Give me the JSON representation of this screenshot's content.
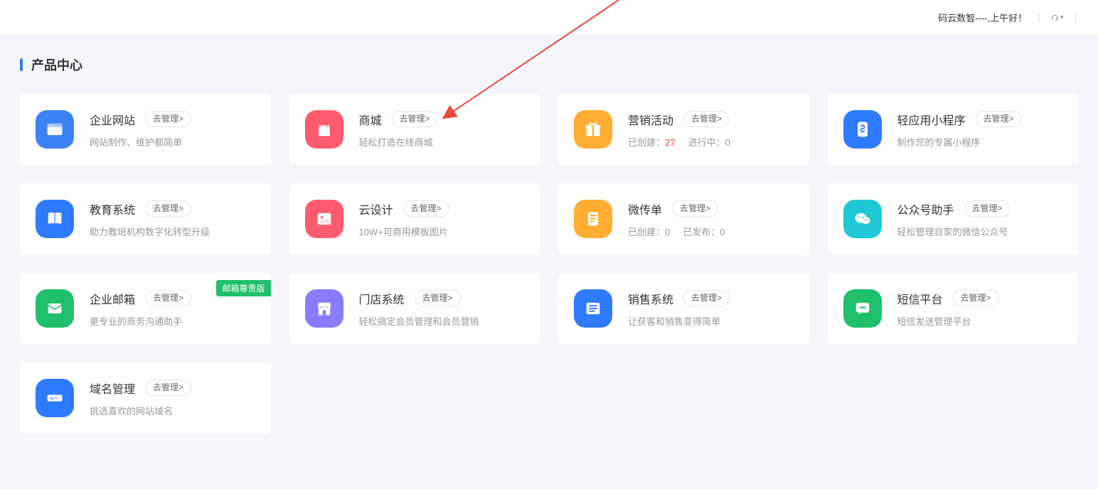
{
  "header": {
    "greeting": "码云数智----,上午好！"
  },
  "section_title": "产品中心",
  "manage_label": "去管理>",
  "cards": [
    {
      "title": "企业网站",
      "desc": "网站制作、维护都简单",
      "icon": "window",
      "color": "#3b82f6",
      "badge": null
    },
    {
      "title": "商城",
      "desc": "轻松打造在线商城",
      "icon": "bag",
      "color": "#ff5b6e",
      "badge": null
    },
    {
      "title": "营销活动",
      "desc_created_label": "已创建：",
      "desc_created_val": "27",
      "desc_running_label": "进行中：",
      "desc_running_val": "0",
      "icon": "gift",
      "color": "#ffad33",
      "badge": null
    },
    {
      "title": "轻应用小程序",
      "desc": "制作您的专属小程序",
      "icon": "miniprog",
      "color": "#2f7bff",
      "badge": null
    },
    {
      "title": "教育系统",
      "desc": "助力教培机构数字化转型升级",
      "icon": "book",
      "color": "#2f7bff",
      "badge": null
    },
    {
      "title": "云设计",
      "desc": "10W+可商用模板图片",
      "icon": "image",
      "color": "#ff5b6e",
      "badge": null
    },
    {
      "title": "微传单",
      "desc_created_label": "已创建：",
      "desc_created_val": "0",
      "desc_running_label": "已发布：",
      "desc_running_val": "0",
      "icon": "flyer",
      "color": "#ffad33",
      "badge": null
    },
    {
      "title": "公众号助手",
      "desc": "轻松管理自家的微信公众号",
      "icon": "wechat",
      "color": "#1fc8d6",
      "badge": null
    },
    {
      "title": "企业邮箱",
      "desc": "更专业的商务沟通助手",
      "icon": "envelope",
      "color": "#1fbf6c",
      "badge": "邮箱尊贵版"
    },
    {
      "title": "门店系统",
      "desc": "轻松搞定会员管理和会员营销",
      "icon": "store",
      "color": "#8b7bff",
      "badge": null
    },
    {
      "title": "销售系统",
      "desc": "让获客和销售变得简单",
      "icon": "list",
      "color": "#2f7bff",
      "badge": null
    },
    {
      "title": "短信平台",
      "desc": "短信发送管理平台",
      "icon": "chat",
      "color": "#1fbf6c",
      "badge": null
    },
    {
      "title": "域名管理",
      "desc": "挑选喜欢的网站域名",
      "icon": "domain",
      "color": "#2f7bff",
      "badge": null
    }
  ]
}
